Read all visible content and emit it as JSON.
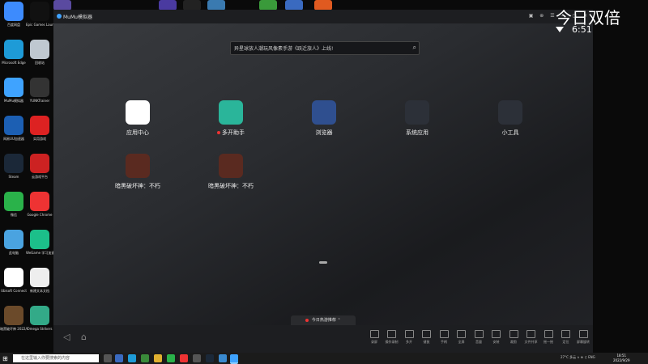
{
  "desktop_icons": [
    {
      "label": "百度网盘",
      "color": "#3d8bfd"
    },
    {
      "label": "Epic Games Launcher",
      "color": "#111"
    },
    {
      "label": "Microsoft Edge",
      "color": "#1e9bd7"
    },
    {
      "label": "回收站",
      "color": "#bfc8d0"
    },
    {
      "label": "MuMu模拟器",
      "color": "#3fa3ff"
    },
    {
      "label": "YUNKTrainer",
      "color": "#333"
    },
    {
      "label": "网易UU加速器",
      "color": "#1c5fb3"
    },
    {
      "label": "实用游戏",
      "color": "#d22"
    },
    {
      "label": "Steam",
      "color": "#1b2838"
    },
    {
      "label": "云游戏平台",
      "color": "#c22"
    },
    {
      "label": "微信",
      "color": "#2ab24a"
    },
    {
      "label": "Google Chrome",
      "color": "#e33"
    },
    {
      "label": "此电脑",
      "color": "#4aa3e0"
    },
    {
      "label": "WeGame 学习加速器",
      "color": "#1cbf8a"
    },
    {
      "label": "Ubisoft Connect",
      "color": "#fff"
    },
    {
      "label": "新建文本文档",
      "color": "#eee"
    },
    {
      "label": "暗黑破坏神 2022/07/09",
      "color": "#6b4a2a"
    },
    {
      "label": "Omega Strikers",
      "color": "#3a8"
    }
  ],
  "window": {
    "title": "MuMu模拟器",
    "controls": "▣ ⊕ ☰ — ▢ ✕"
  },
  "overlay": {
    "title": "今日双倍",
    "time": "6:51"
  },
  "search": {
    "placeholder": "异星球放人潮玩风像素手游《跃迁旅人》上线!"
  },
  "apps": [
    {
      "label": "应用中心",
      "color": "#ffffff",
      "dot": false
    },
    {
      "label": "多开助手",
      "color": "#2ab59a",
      "dot": true
    },
    {
      "label": "浏览器",
      "color": "#2f4f8f",
      "dot": false
    },
    {
      "label": "系统应用",
      "color": "#2c3038",
      "dot": false
    },
    {
      "label": "小工具",
      "color": "#2c3038",
      "dot": false
    },
    {
      "label": "暗黑破坏神：不朽",
      "color": "#5a2a20",
      "dot": false
    },
    {
      "label": "暗黑破坏神：不朽",
      "color": "#5a2a20",
      "dot": false
    }
  ],
  "recommend": {
    "label": "今日热游推荐"
  },
  "bottom_nav": {
    "back": "◁",
    "home": "⌂"
  },
  "toolbar": [
    "录屏",
    "操作录制",
    "多开",
    "键鼠",
    "手柄",
    "全屏",
    "音量",
    "安装",
    "裁剪",
    "文件共享",
    "摇一摇",
    "定位",
    "屏幕旋转"
  ],
  "taskbar": {
    "search_placeholder": "在这里输入你要搜索的内容",
    "tray": "27°C 多云  ∧ ⊕ ♫ ENG",
    "clock_time": "18:51",
    "clock_date": "2022/9/29"
  }
}
